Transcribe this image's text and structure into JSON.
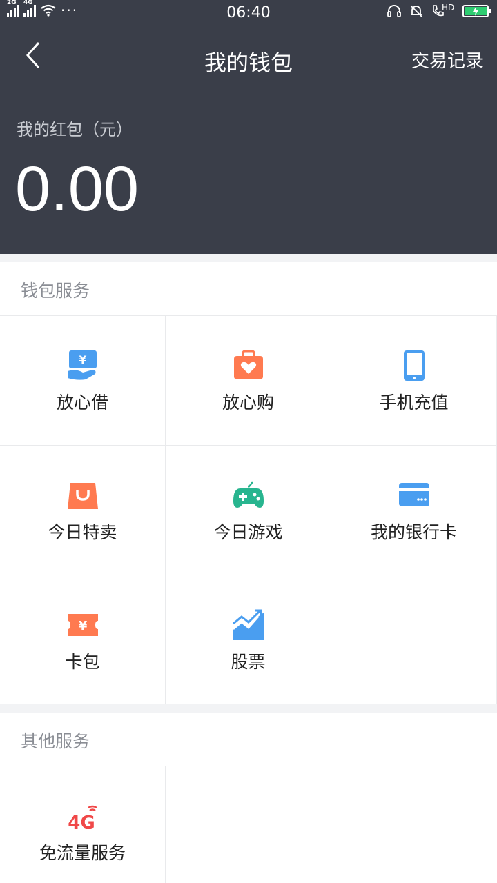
{
  "status_bar": {
    "net1": "2G",
    "net2": "4G",
    "more": "···",
    "time": "06:40",
    "hd": "HD",
    "battery_color": "#2ecc71"
  },
  "navbar": {
    "back_icon": "chevron-left-icon",
    "title": "我的钱包",
    "action": "交易记录"
  },
  "wallet": {
    "label": "我的红包（元）",
    "amount": "0.00"
  },
  "wallet_services": {
    "header": "钱包服务",
    "items": [
      {
        "label": "放心借",
        "icon": "loan-icon",
        "color": "#4a9ef0"
      },
      {
        "label": "放心购",
        "icon": "shopping-bag-heart-icon",
        "color": "#ff7a50"
      },
      {
        "label": "手机充值",
        "icon": "phone-icon",
        "color": "#4a9ef0"
      },
      {
        "label": "今日特卖",
        "icon": "sale-bag-icon",
        "color": "#ff7a50"
      },
      {
        "label": "今日游戏",
        "icon": "gamepad-icon",
        "color": "#28b58f"
      },
      {
        "label": "我的银行卡",
        "icon": "bank-card-icon",
        "color": "#4a9ef0"
      },
      {
        "label": "卡包",
        "icon": "ticket-icon",
        "color": "#ff7a50"
      },
      {
        "label": "股票",
        "icon": "stock-chart-icon",
        "color": "#4a9ef0"
      }
    ]
  },
  "other_services": {
    "header": "其他服务",
    "items": [
      {
        "label": "免流量服务",
        "icon": "4g-icon",
        "icon_text": "4G",
        "color": "#f04848"
      }
    ]
  }
}
